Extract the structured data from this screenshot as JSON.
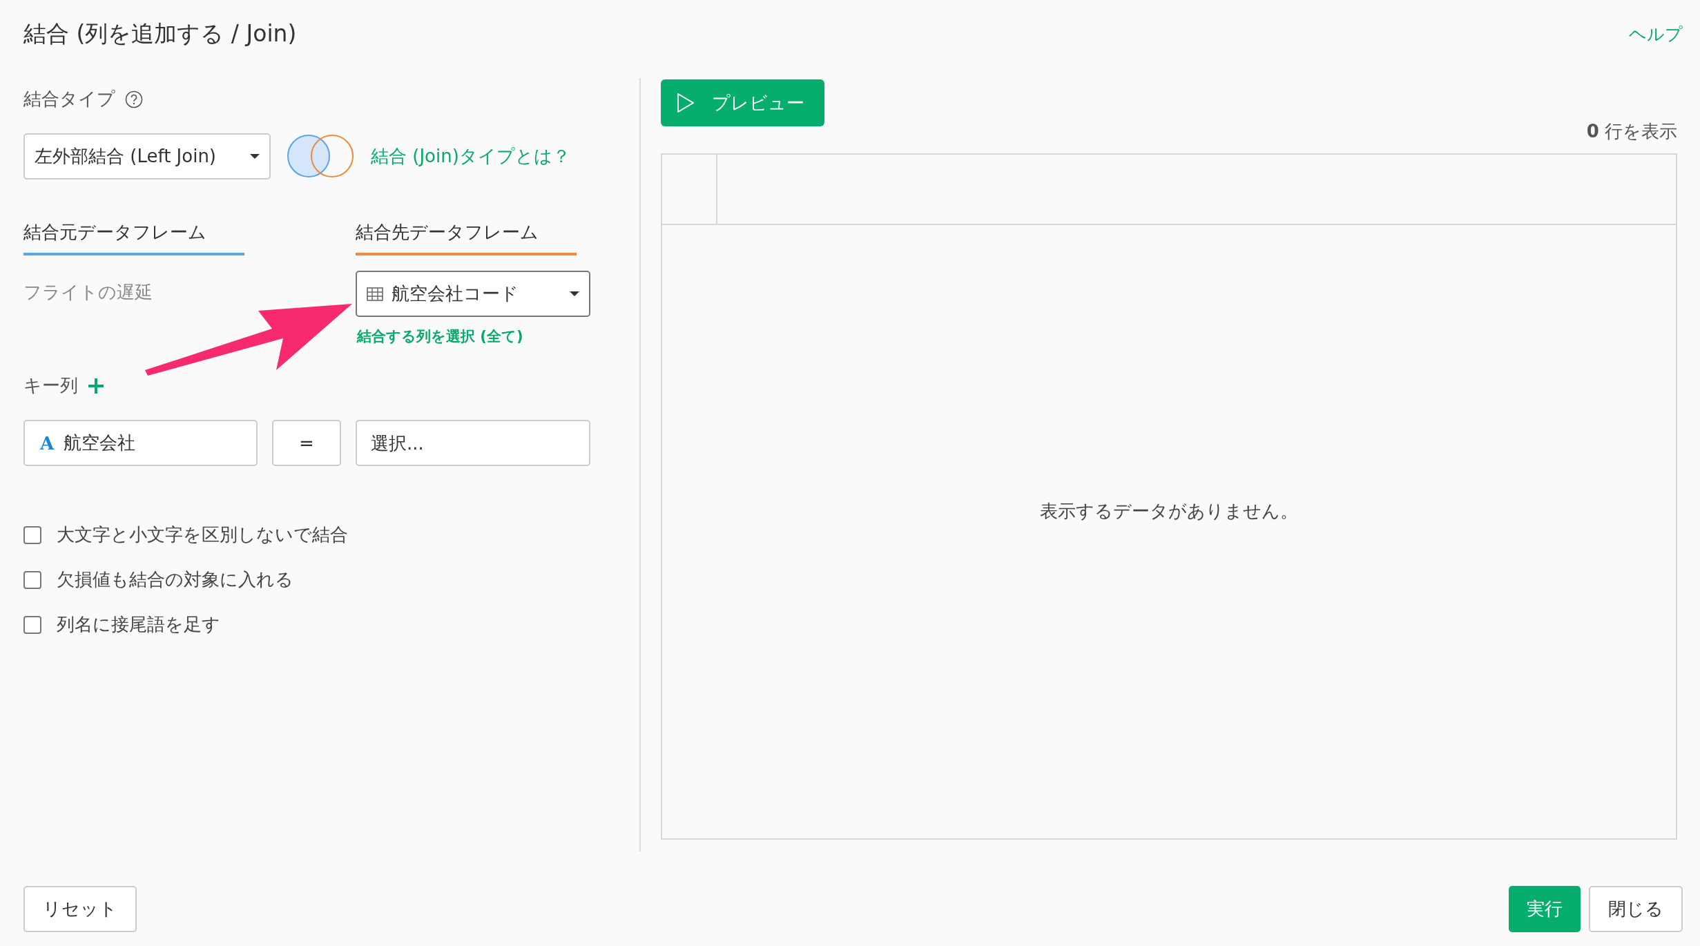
{
  "title": "結合 (列を追加する / Join)",
  "help_link": "ヘルプ",
  "join_type": {
    "label": "結合タイプ",
    "value": "左外部結合 (Left Join)",
    "link": "結合 (Join)タイプとは？"
  },
  "frames": [
    {
      "label": "結合元データフレーム",
      "color": "#5aa5ea",
      "value": "フライトの遅延",
      "kind": "text"
    },
    {
      "label": "結合先データフレーム",
      "color": "#ec8b3a",
      "value": "航空会社コード",
      "kind": "dropdown",
      "link": "結合する列を選択 (全て)"
    }
  ],
  "key_columns": {
    "label": "キー列",
    "rows": [
      {
        "type_icon": "A",
        "left": "航空会社",
        "operator": "=",
        "right_placeholder": "選択..."
      }
    ]
  },
  "options": [
    {
      "label": "大文字と小文字を区別しないで結合",
      "checked": false
    },
    {
      "label": "欠損値も結合の対象に入れる",
      "checked": false
    },
    {
      "label": "列名に接尾語を足す",
      "checked": false
    }
  ],
  "preview": {
    "button": "プレビュー",
    "row_count": "**0** 行を表示",
    "empty_message": "表示するデータがありません。"
  },
  "buttons": [
    {
      "label": "リセット",
      "kind": "secondary"
    },
    {
      "label": "実行",
      "kind": "primary"
    },
    {
      "label": "閉じる",
      "kind": "secondary"
    }
  ]
}
